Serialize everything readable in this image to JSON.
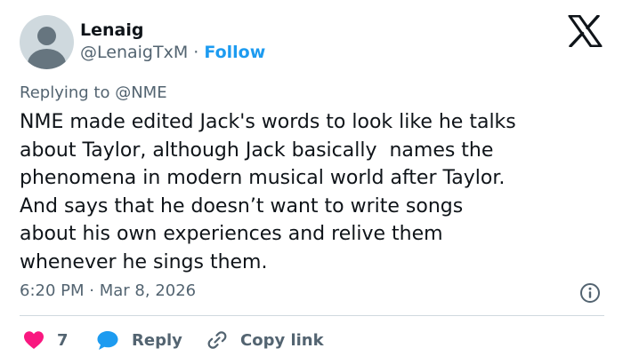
{
  "author": {
    "name": "Lenaig",
    "handle": "@LenaigTxM",
    "separator": "·",
    "follow_label": "Follow"
  },
  "reply_context": {
    "prefix": "Replying to",
    "mention": "@NME"
  },
  "tweet": {
    "text": "NME made edited Jack's words to look like he talks\nabout Taylor, although Jack basically  names the\nphenomena in modern musical world after Taylor.\nAnd says that he doesn’t want to write songs\nabout his own experiences and relive them\nwhenever he sings them.",
    "time": "6:20 PM",
    "separator": "·",
    "date": "Mar 8, 2026"
  },
  "actions": {
    "like_count": "7",
    "reply_label": "Reply",
    "copy_label": "Copy link"
  },
  "colors": {
    "text": "#0f1419",
    "secondary": "#536471",
    "link": "#1d9bf0",
    "like": "#f91880",
    "divider": "#cfd9de"
  },
  "icons": [
    "default-avatar",
    "x-logo-icon",
    "info-icon",
    "heart-icon",
    "reply-bubble-icon",
    "link-icon"
  ]
}
